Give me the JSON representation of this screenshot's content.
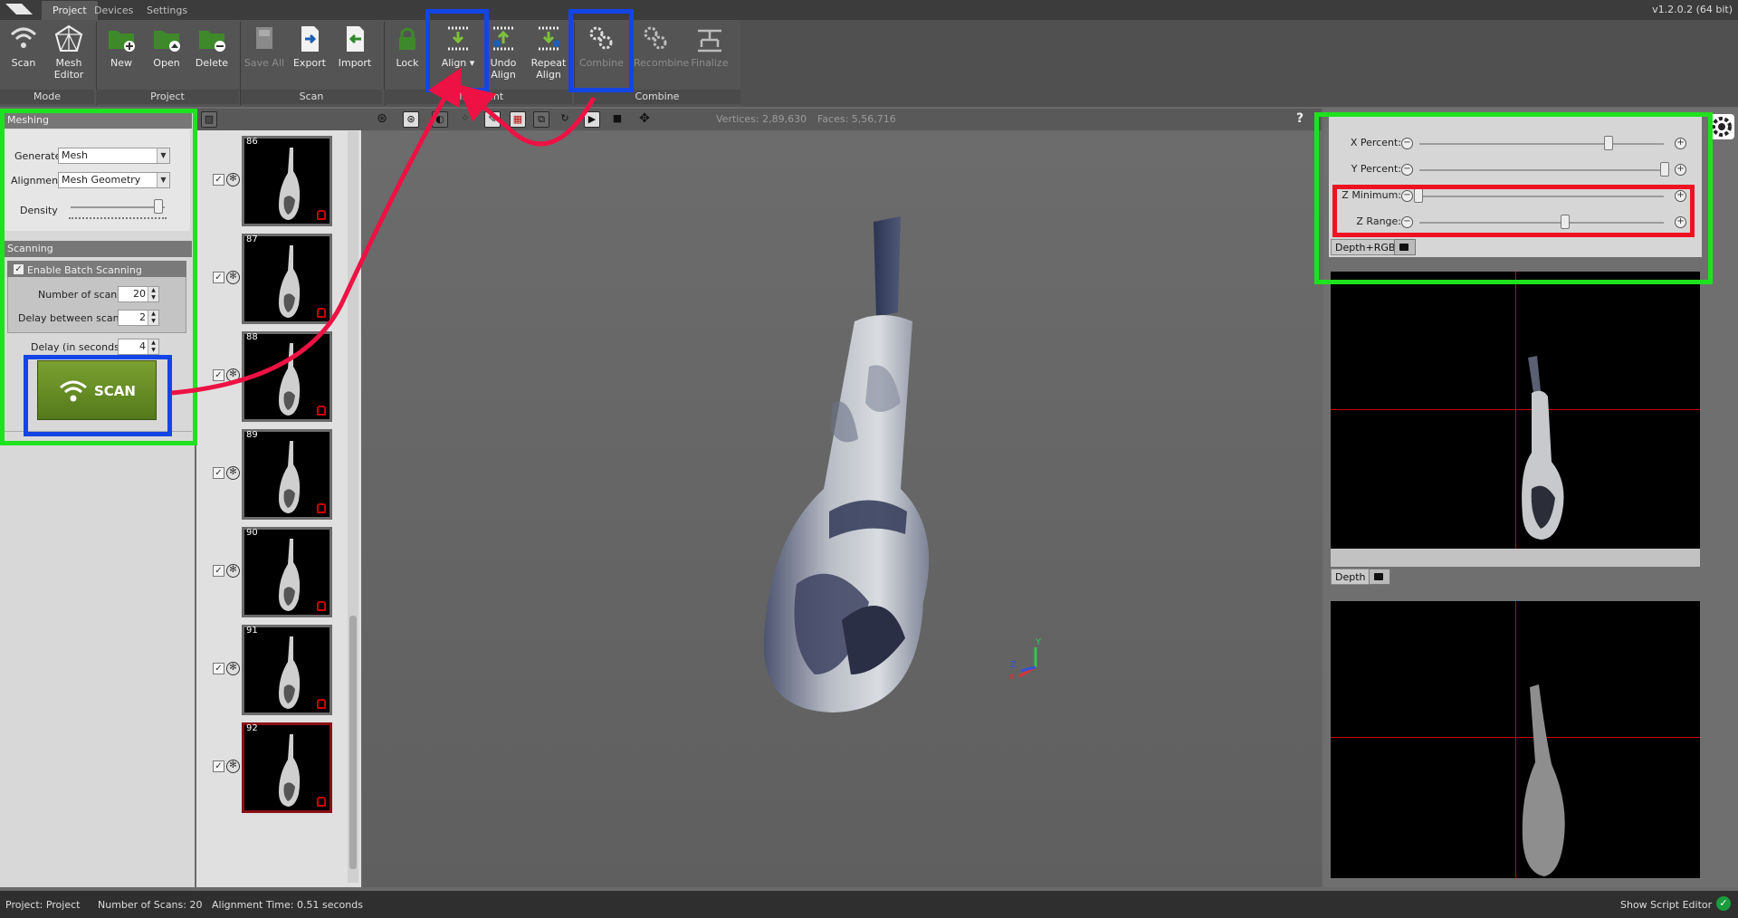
{
  "app": {
    "tabs": [
      "Project",
      "Devices",
      "Settings"
    ],
    "active_tab": "Project",
    "version": "v1.2.0.2 (64 bit)"
  },
  "ribbon": {
    "buttons": {
      "scan": "Scan",
      "mesh_editor_l1": "Mesh",
      "mesh_editor_l2": "Editor",
      "new": "New",
      "open": "Open",
      "delete": "Delete",
      "save_all": "Save All",
      "export": "Export",
      "import": "Import",
      "lock": "Lock",
      "align": "Align",
      "undo_align_l1": "Undo",
      "undo_align_l2": "Align",
      "repeat_align_l1": "Repeat",
      "repeat_align_l2": "Align",
      "combine": "Combine",
      "recombine": "Recombine",
      "finalize": "Finalize"
    },
    "groups": [
      "Mode",
      "Project",
      "Scan",
      "Alignment",
      "Combine"
    ]
  },
  "left_panel": {
    "meshing_header": "Meshing",
    "generate_label": "Generate",
    "generate_value": "Mesh",
    "alignment_label": "Alignment",
    "alignment_value": "Mesh Geometry",
    "density_label": "Density",
    "scanning_header": "Scanning",
    "batch_label": "Enable Batch Scanning",
    "num_scans_label": "Number of scans",
    "num_scans_value": "20",
    "delay_between_label": "Delay between scans",
    "delay_between_value": "2",
    "delay_seconds_label": "Delay (in seconds)",
    "delay_seconds_value": "4",
    "scan_button": "SCAN"
  },
  "thumbnails": [
    "86",
    "87",
    "88",
    "89",
    "90",
    "91",
    "92"
  ],
  "viewport": {
    "vertices": "Vertices: 2,89,630",
    "faces": "Faces: 5,56,716",
    "help": "?"
  },
  "right_panel": {
    "x_percent": "X Percent:",
    "y_percent": "Y Percent:",
    "z_minimum": "Z Minimum:",
    "z_range": "Z Range:",
    "depth_rgb_tab": "Depth+RGB",
    "depth_tab": "Depth"
  },
  "status": {
    "project": "Project: Project",
    "num_scans": "Number of Scans:  20",
    "alignment_time": "Alignment Time:  0.51 seconds",
    "script_editor": "Show Script Editor"
  },
  "colors": {
    "annotation_green": "#1ee21e",
    "annotation_blue": "#1345e6",
    "annotation_red": "#ee1122",
    "arrow": "#ee1144",
    "scan_button": "#6a9028"
  }
}
